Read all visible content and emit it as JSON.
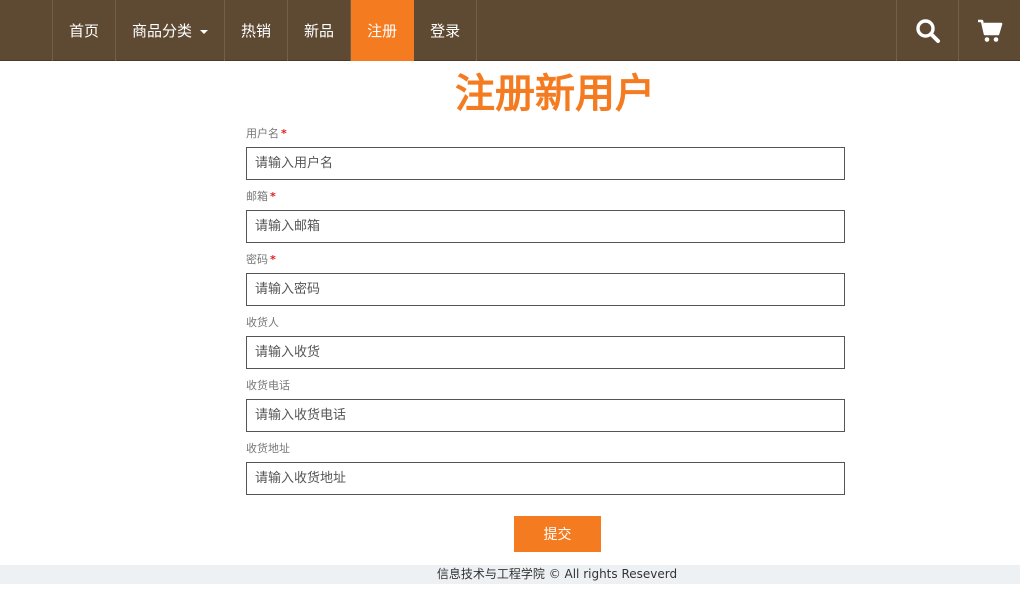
{
  "nav": {
    "items": [
      {
        "label": "首页",
        "active": false
      },
      {
        "label": "商品分类",
        "active": false,
        "dropdown": true
      },
      {
        "label": "热销",
        "active": false
      },
      {
        "label": "新品",
        "active": false
      },
      {
        "label": "注册",
        "active": true
      },
      {
        "label": "登录",
        "active": false
      }
    ],
    "icons": [
      "search-icon",
      "cart-icon"
    ]
  },
  "page": {
    "title": "注册新用户"
  },
  "form": {
    "fields": [
      {
        "label": "用户名",
        "required": "*",
        "placeholder": "请输入用户名",
        "value": ""
      },
      {
        "label": "邮箱",
        "required": "*",
        "placeholder": "请输入邮箱",
        "value": ""
      },
      {
        "label": "密码",
        "required": "*",
        "placeholder": "请输入密码",
        "value": ""
      },
      {
        "label": "收货人",
        "required": "",
        "placeholder": "请输入收货",
        "value": ""
      },
      {
        "label": "收货电话",
        "required": "",
        "placeholder": "请输入收货电话",
        "value": ""
      },
      {
        "label": "收货地址",
        "required": "",
        "placeholder": "请输入收货地址",
        "value": ""
      }
    ],
    "submit_label": "提交"
  },
  "footer": {
    "text": "信息技术与工程学院 © All rights Reseverd"
  },
  "colors": {
    "navbar_bg": "#5e4a33",
    "accent": "#f47b20",
    "required": "#e11d1d",
    "footer_bg": "#eef1f3"
  }
}
